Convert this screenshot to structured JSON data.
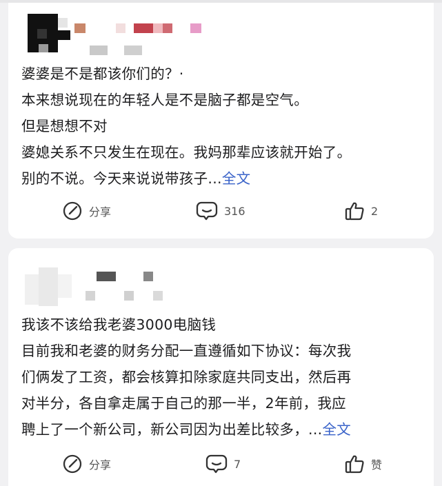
{
  "feed": {
    "posts": [
      {
        "lines": [
          "婆婆是不是都该你们的？·",
          "本来想说现在的年轻人是不是脑子都是空气。",
          "但是想想不对",
          "婆媳关系不只发生在现在。我妈那辈应该就开始了。",
          "别的不说。今天来说说带孩子..."
        ],
        "more_label": "全文",
        "actions": {
          "share_label": "分享",
          "comment_count": "316",
          "like_count": "2"
        }
      },
      {
        "lines": [
          "我该不该给我老婆3000电脑钱",
          "目前我和老婆的财务分配一直遵循如下协议：每次我",
          "们俩发了工资，都会核算扣除家庭共同支出，然后再",
          "对半分，各自拿走属于自己的那一半，2年前，我应",
          "聘上了一个新公司，新公司因为出差比较多，..."
        ],
        "more_label": "全文",
        "actions": {
          "share_label": "分享",
          "comment_count": "7",
          "like_label": "赞"
        }
      }
    ]
  },
  "colors": {
    "background": "#f1f1f3",
    "card": "#ffffff",
    "text": "#1d1d1f",
    "link": "#3a63c9",
    "action": "#555555"
  },
  "icons": {
    "share": "share-edit-icon",
    "comment": "comment-bubble-icon",
    "like": "thumbs-up-icon"
  }
}
